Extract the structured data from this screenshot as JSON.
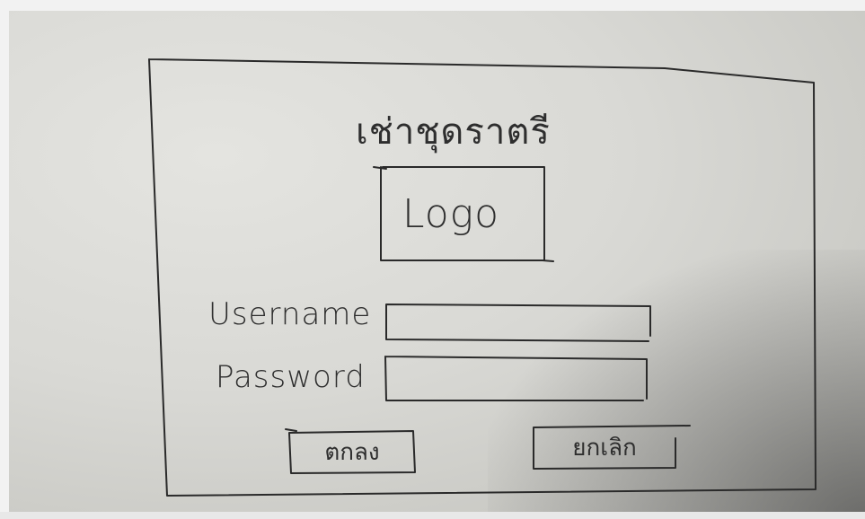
{
  "form": {
    "title": "เช่าชุดราตรี",
    "logo_label": "Logo",
    "username_label": "Username",
    "password_label": "Password",
    "username_value": "",
    "password_value": ""
  },
  "buttons": {
    "ok_label": "ตกลง",
    "cancel_label": "ยกเลิก"
  },
  "colors": {
    "ink": "#2a2a2a",
    "paper": "#d9d9d5"
  }
}
